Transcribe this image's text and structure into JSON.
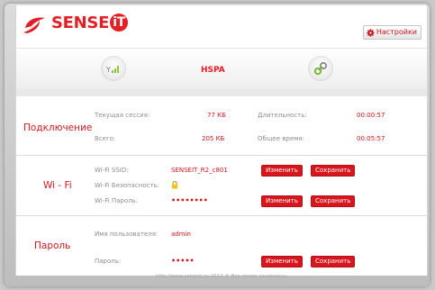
{
  "colors": {
    "accent": "#d3161c",
    "label": "#8d8d8d",
    "button": "#d9161d"
  },
  "header": {
    "brand": "SENSE",
    "brand_badge": "iT",
    "settings_label": "Настройки",
    "settings_icon": "gear-icon"
  },
  "status": {
    "signal_icon": "signal-strength-icon",
    "network_type": "HSPA",
    "connection_icon": "connected-link-icon"
  },
  "connection": {
    "title": "Подключение",
    "session_label": "Текущая сессия:",
    "session_value": "77 КБ",
    "duration_label": "Длительность:",
    "duration_value": "00:00:57",
    "total_label": "Всего:",
    "total_value": "205 КБ",
    "total_time_label": "Общее время:",
    "total_time_value": "00:05:57"
  },
  "wifi": {
    "title": "Wi - Fi",
    "ssid_label": "Wi-Fi SSID:",
    "ssid_value": "SENSEIT_R2_c801",
    "security_label": "Wi-Fi Безопасность:",
    "security_icon": "lock-icon",
    "password_label": "Wi-Fi Пароль:",
    "password_value": "••••••••",
    "change_label": "Изменить",
    "save_label": "Сохранить"
  },
  "password": {
    "title": "Пароль",
    "user_label": "Имя пользователя:",
    "user_value": "admin",
    "password_label": "Пароль:",
    "password_value": "•••••",
    "change_label": "Изменить",
    "save_label": "Сохранить"
  },
  "footer": {
    "text": "http://www.senseit.ru 2012 © Все права защищены"
  }
}
